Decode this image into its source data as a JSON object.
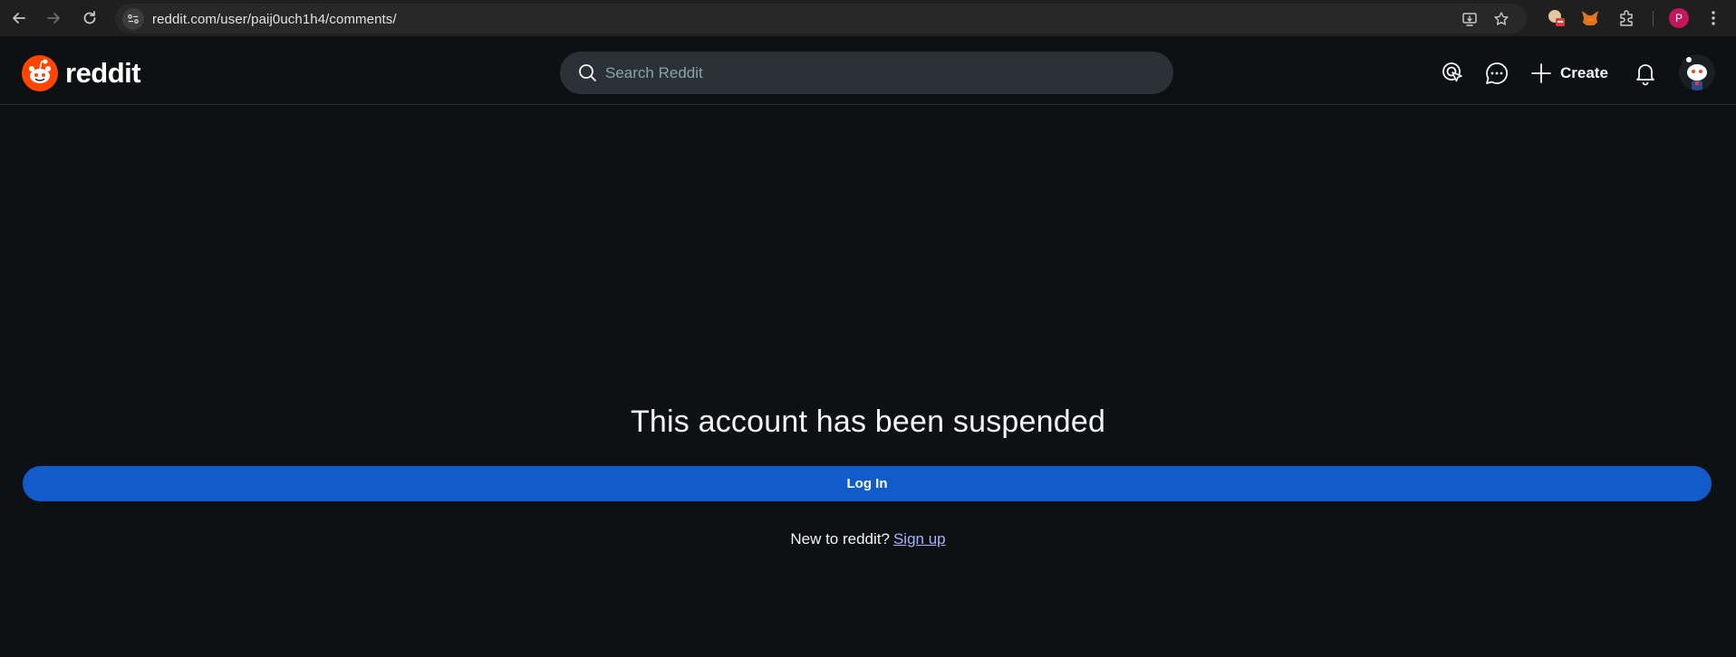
{
  "browser": {
    "url": "reddit.com/user/paij0uch1h4/comments/",
    "profile_initial": "P"
  },
  "header": {
    "logo_text": "reddit",
    "search_placeholder": "Search Reddit",
    "create_label": "Create"
  },
  "main": {
    "title": "This account has been suspended",
    "login_label": "Log In",
    "signup_prompt": "New to reddit?",
    "signup_link": "Sign up"
  },
  "colors": {
    "background": "#0e1113",
    "brand_orange": "#ff4500",
    "login_button": "#115bca",
    "search_bg": "#2a3236",
    "link": "#a5b4fc"
  },
  "icons": [
    "back-arrow-icon",
    "forward-arrow-icon",
    "reload-icon",
    "site-info-icon",
    "install-app-icon",
    "bookmark-star-icon",
    "extension-puzzle-icon",
    "kebab-menu-icon",
    "reddit-logo-icon",
    "search-icon",
    "advertise-icon",
    "chat-icon",
    "plus-icon",
    "bell-icon",
    "avatar"
  ]
}
